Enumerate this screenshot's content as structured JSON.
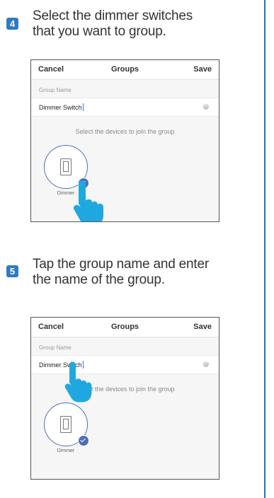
{
  "steps": [
    {
      "number": "4",
      "text_line1": "Select the dimmer switches",
      "text_line2": "that you want to group.",
      "screen": {
        "cancel": "Cancel",
        "title": "Groups",
        "save": "Save",
        "group_name_label": "Group Name",
        "group_name_value": "Dimmer Switch",
        "hint": "Select the devices to join the group",
        "device_label": "Dimmer",
        "device_selected": true
      }
    },
    {
      "number": "5",
      "text_line1": "Tap the group name and enter",
      "text_line2": "the name of the group.",
      "screen": {
        "cancel": "Cancel",
        "title": "Groups",
        "save": "Save",
        "group_name_label": "Group Name",
        "group_name_value": "Dimmer Switch",
        "hint": "Select the devices to join the group",
        "device_label": "Dimmer",
        "device_selected": true
      }
    }
  ],
  "colors": {
    "accent": "#2f7cc1",
    "select_ring": "#4f6db6",
    "hand": "#1fa8e0",
    "rule": "#2f6fb6"
  },
  "icons": [
    "pointing-hand-icon",
    "dimmer-switch-icon",
    "checkmark-icon",
    "clear-icon"
  ]
}
